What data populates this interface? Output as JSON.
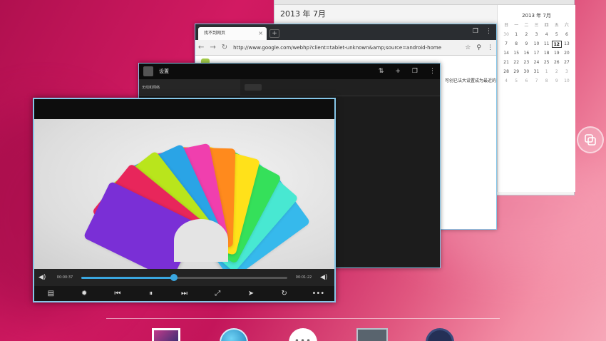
{
  "calendar": {
    "month_title": "2013 年 7月",
    "side_title": "2013 年 7月",
    "days": [
      {
        "t": "日",
        "c": "head"
      },
      {
        "t": "一",
        "c": "head"
      },
      {
        "t": "二",
        "c": "head"
      },
      {
        "t": "三",
        "c": "head"
      },
      {
        "t": "四",
        "c": "head"
      },
      {
        "t": "五",
        "c": "head"
      },
      {
        "t": "六",
        "c": "head"
      },
      {
        "t": "30",
        "c": "dim"
      },
      {
        "t": "1",
        "c": ""
      },
      {
        "t": "2",
        "c": ""
      },
      {
        "t": "3",
        "c": ""
      },
      {
        "t": "4",
        "c": ""
      },
      {
        "t": "5",
        "c": ""
      },
      {
        "t": "6",
        "c": ""
      },
      {
        "t": "7",
        "c": ""
      },
      {
        "t": "8",
        "c": ""
      },
      {
        "t": "9",
        "c": ""
      },
      {
        "t": "10",
        "c": ""
      },
      {
        "t": "11",
        "c": ""
      },
      {
        "t": "12",
        "c": "today"
      },
      {
        "t": "13",
        "c": ""
      },
      {
        "t": "14",
        "c": ""
      },
      {
        "t": "15",
        "c": ""
      },
      {
        "t": "16",
        "c": ""
      },
      {
        "t": "17",
        "c": ""
      },
      {
        "t": "18",
        "c": ""
      },
      {
        "t": "19",
        "c": ""
      },
      {
        "t": "20",
        "c": ""
      },
      {
        "t": "21",
        "c": ""
      },
      {
        "t": "22",
        "c": ""
      },
      {
        "t": "23",
        "c": ""
      },
      {
        "t": "24",
        "c": ""
      },
      {
        "t": "25",
        "c": ""
      },
      {
        "t": "26",
        "c": ""
      },
      {
        "t": "27",
        "c": ""
      },
      {
        "t": "28",
        "c": ""
      },
      {
        "t": "29",
        "c": ""
      },
      {
        "t": "30",
        "c": ""
      },
      {
        "t": "31",
        "c": ""
      },
      {
        "t": "1",
        "c": "dim"
      },
      {
        "t": "2",
        "c": "dim"
      },
      {
        "t": "3",
        "c": "dim"
      },
      {
        "t": "4",
        "c": "dim"
      },
      {
        "t": "5",
        "c": "dim"
      },
      {
        "t": "6",
        "c": "dim"
      },
      {
        "t": "7",
        "c": "dim"
      },
      {
        "t": "8",
        "c": "dim"
      },
      {
        "t": "9",
        "c": "dim"
      },
      {
        "t": "10",
        "c": "dim"
      }
    ]
  },
  "browser": {
    "tab_title": "找不到网页",
    "tab_close": "×",
    "new_tab": "+",
    "url": "http://www.google.com/webhp?client=tablet-unknown&amp;source=android-home",
    "snippet": "可创已法大设置成为最近的"
  },
  "settings": {
    "title": "设置",
    "list_item": "无线和网络"
  },
  "player": {
    "time_elapsed": "00:00:37",
    "time_total": "00:01:22",
    "progress": 0.45,
    "card_colors": [
      "#7a2fd6",
      "#e8265b",
      "#b9e51c",
      "#2aa4e6",
      "#f03fae",
      "#ff8a1d",
      "#ffe11a",
      "#35e05a",
      "#48e8d2",
      "#36b9ec"
    ]
  },
  "icons": {
    "vol_left": "◀)",
    "vol_right": "◀)",
    "ctrl_menu": "▤",
    "ctrl_brightness": "✹",
    "ctrl_prev": "⏮",
    "ctrl_pause": "⏸",
    "ctrl_next": "⏭",
    "ctrl_fullscreen": "⤢",
    "ctrl_cursor": "➤",
    "ctrl_rotate": "↻",
    "ctrl_more": "•••",
    "back": "←",
    "forward": "→",
    "reload": "↻",
    "star": "☆",
    "search": "⚲",
    "sync": "⇅",
    "add": "+",
    "windows": "❐",
    "menu": "⋮",
    "apps": "•••"
  }
}
